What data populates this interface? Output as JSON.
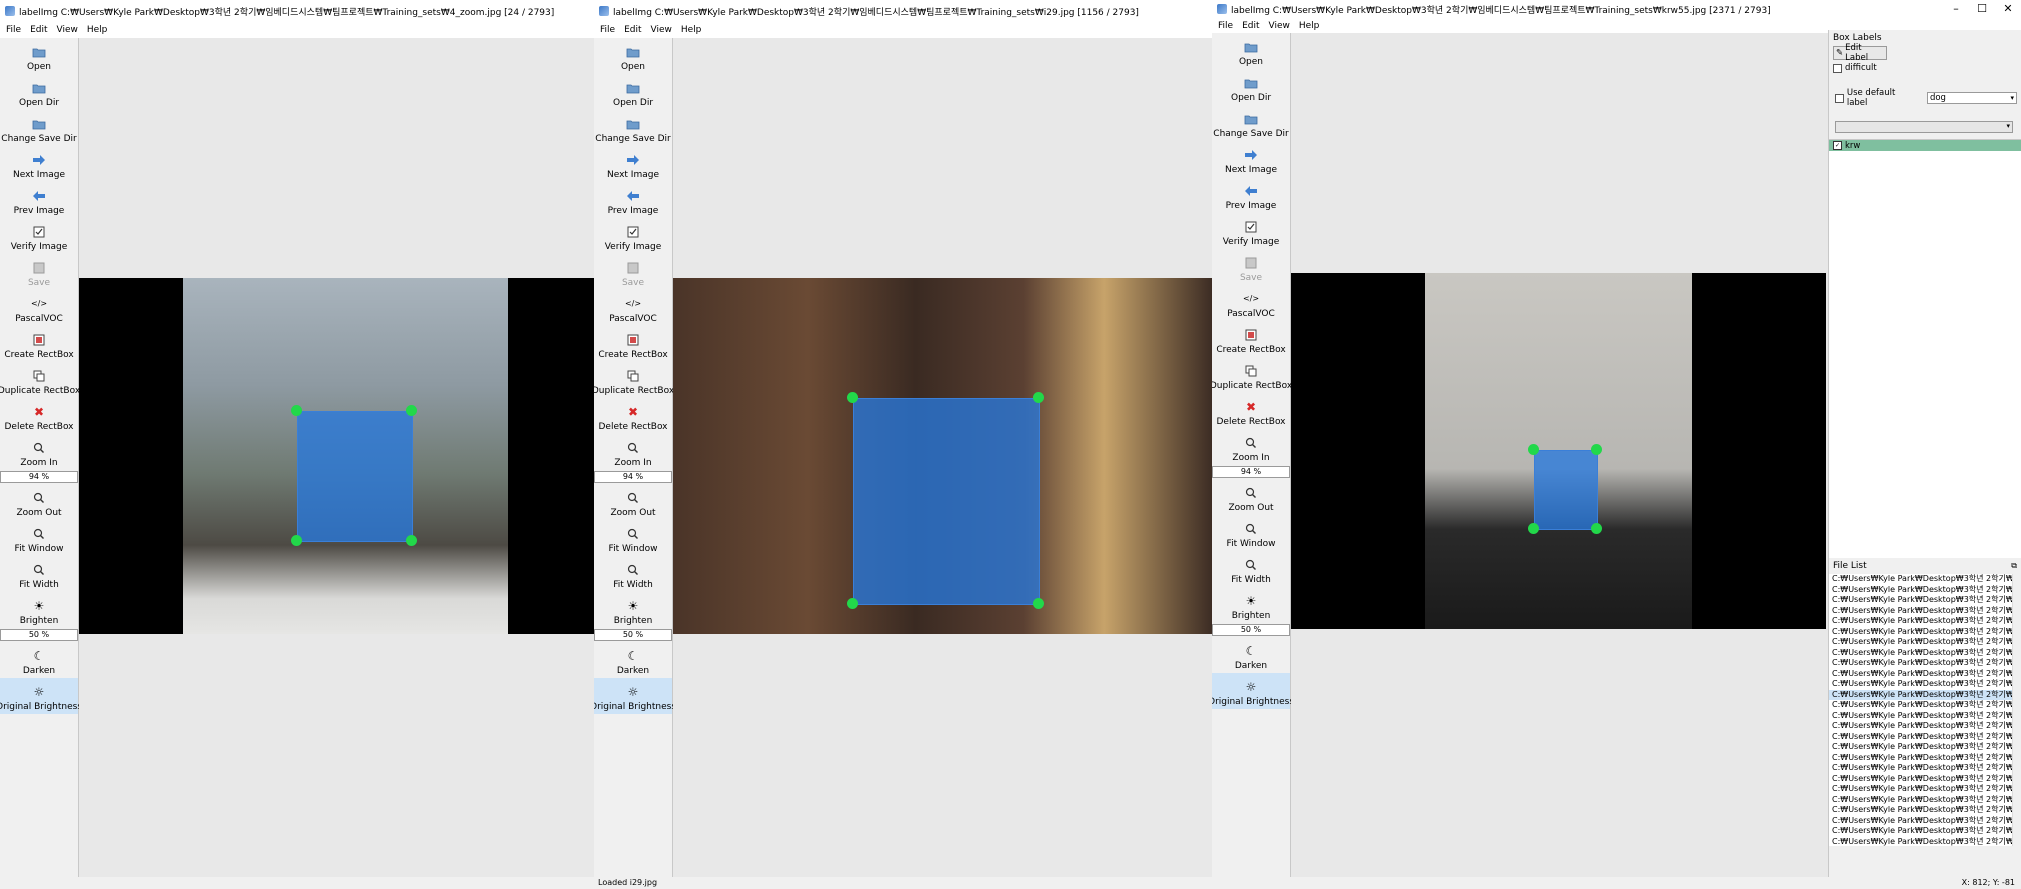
{
  "windows": [
    {
      "title": "labelImg C:₩Users₩Kyle Park₩Desktop₩3학년 2학기₩임베디드시스템₩팀프로젝트₩Training_sets₩4_zoom.jpg [24 / 2793]",
      "status": ""
    },
    {
      "title": "labelImg C:₩Users₩Kyle Park₩Desktop₩3학년 2학기₩임베디드시스템₩팀프로젝트₩Training_sets₩i29.jpg [1156 / 2793]",
      "status": "Loaded i29.jpg"
    },
    {
      "title": "labelImg C:₩Users₩Kyle Park₩Desktop₩3학년 2학기₩임베디드시스템₩팀프로젝트₩Training_sets₩krw55.jpg [2371 / 2793]",
      "status": ""
    }
  ],
  "menu": {
    "file": "File",
    "edit": "Edit",
    "view": "View",
    "help": "Help"
  },
  "window_controls": {
    "minimize": "–",
    "maximize": "☐",
    "close": "✕"
  },
  "tools": {
    "open": "Open",
    "open_dir": "Open Dir",
    "change_save_dir": "Change Save Dir",
    "next_image": "Next Image",
    "prev_image": "Prev Image",
    "verify_image": "Verify Image",
    "save": "Save",
    "format": "PascalVOC",
    "create_rectbox": "Create RectBox",
    "duplicate_rectbox": "Duplicate RectBox",
    "delete_rectbox": "Delete RectBox",
    "zoom_in": "Zoom In",
    "zoom_value": "94 %",
    "zoom_out": "Zoom Out",
    "fit_window": "Fit Window",
    "fit_width": "Fit Width",
    "brighten": "Brighten",
    "brightness_value": "50 %",
    "darken": "Darken",
    "original_brightness": "Original Brightness"
  },
  "icons": {
    "open": "folder-open-icon",
    "next": "arrow-right-icon",
    "prev": "arrow-left-icon",
    "verify": "checkbox-icon",
    "save": "save-icon",
    "format": "code-icon",
    "create": "rectbox-icon",
    "duplicate": "duplicate-icon",
    "delete": "delete-x-icon",
    "zoom": "magnifier-icon",
    "brighten": "sun-icon",
    "darken": "moon-icon"
  },
  "box_labels": {
    "header": "Box Labels",
    "edit_label": "Edit Label",
    "difficult": "difficult",
    "use_default_label": "Use default label",
    "default_label_value": "dog",
    "labels": [
      "krw"
    ]
  },
  "file_list": {
    "header": "File List",
    "item": "C:₩Users₩Kyle Park₩Desktop₩3학년 2학기₩임베디",
    "count": 26,
    "selected_index": 11
  },
  "status_right": "X: 812; Y: -81",
  "colors": {
    "bbox_fill": "#2878dc",
    "handle": "#22d84a",
    "selected_row": "#cde3f7",
    "label_row": "#7fbf9f"
  }
}
